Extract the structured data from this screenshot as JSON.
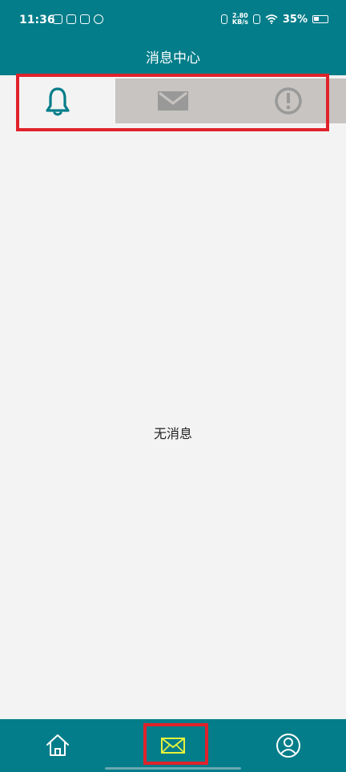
{
  "status_bar": {
    "time": "11:36",
    "net_speed_value": "2.80",
    "net_speed_unit": "KB/s",
    "battery": "35%"
  },
  "header": {
    "title": "消息中心"
  },
  "tabs": [
    {
      "icon": "bell-icon",
      "selected": true
    },
    {
      "icon": "mail-icon",
      "selected": false
    },
    {
      "icon": "alert-circle-icon",
      "selected": false
    }
  ],
  "main": {
    "empty_text": "无消息"
  },
  "bottom_nav": [
    {
      "icon": "home-icon"
    },
    {
      "icon": "mail-icon",
      "selected": true
    },
    {
      "icon": "user-icon"
    }
  ],
  "colors": {
    "primary": "#037d8a",
    "tab_bg": "#c7c4c1",
    "content_bg": "#f3f3f3",
    "inactive_icon": "#999999",
    "highlight": "#e0222b",
    "selected_nav_icon": "#e6f23a"
  }
}
